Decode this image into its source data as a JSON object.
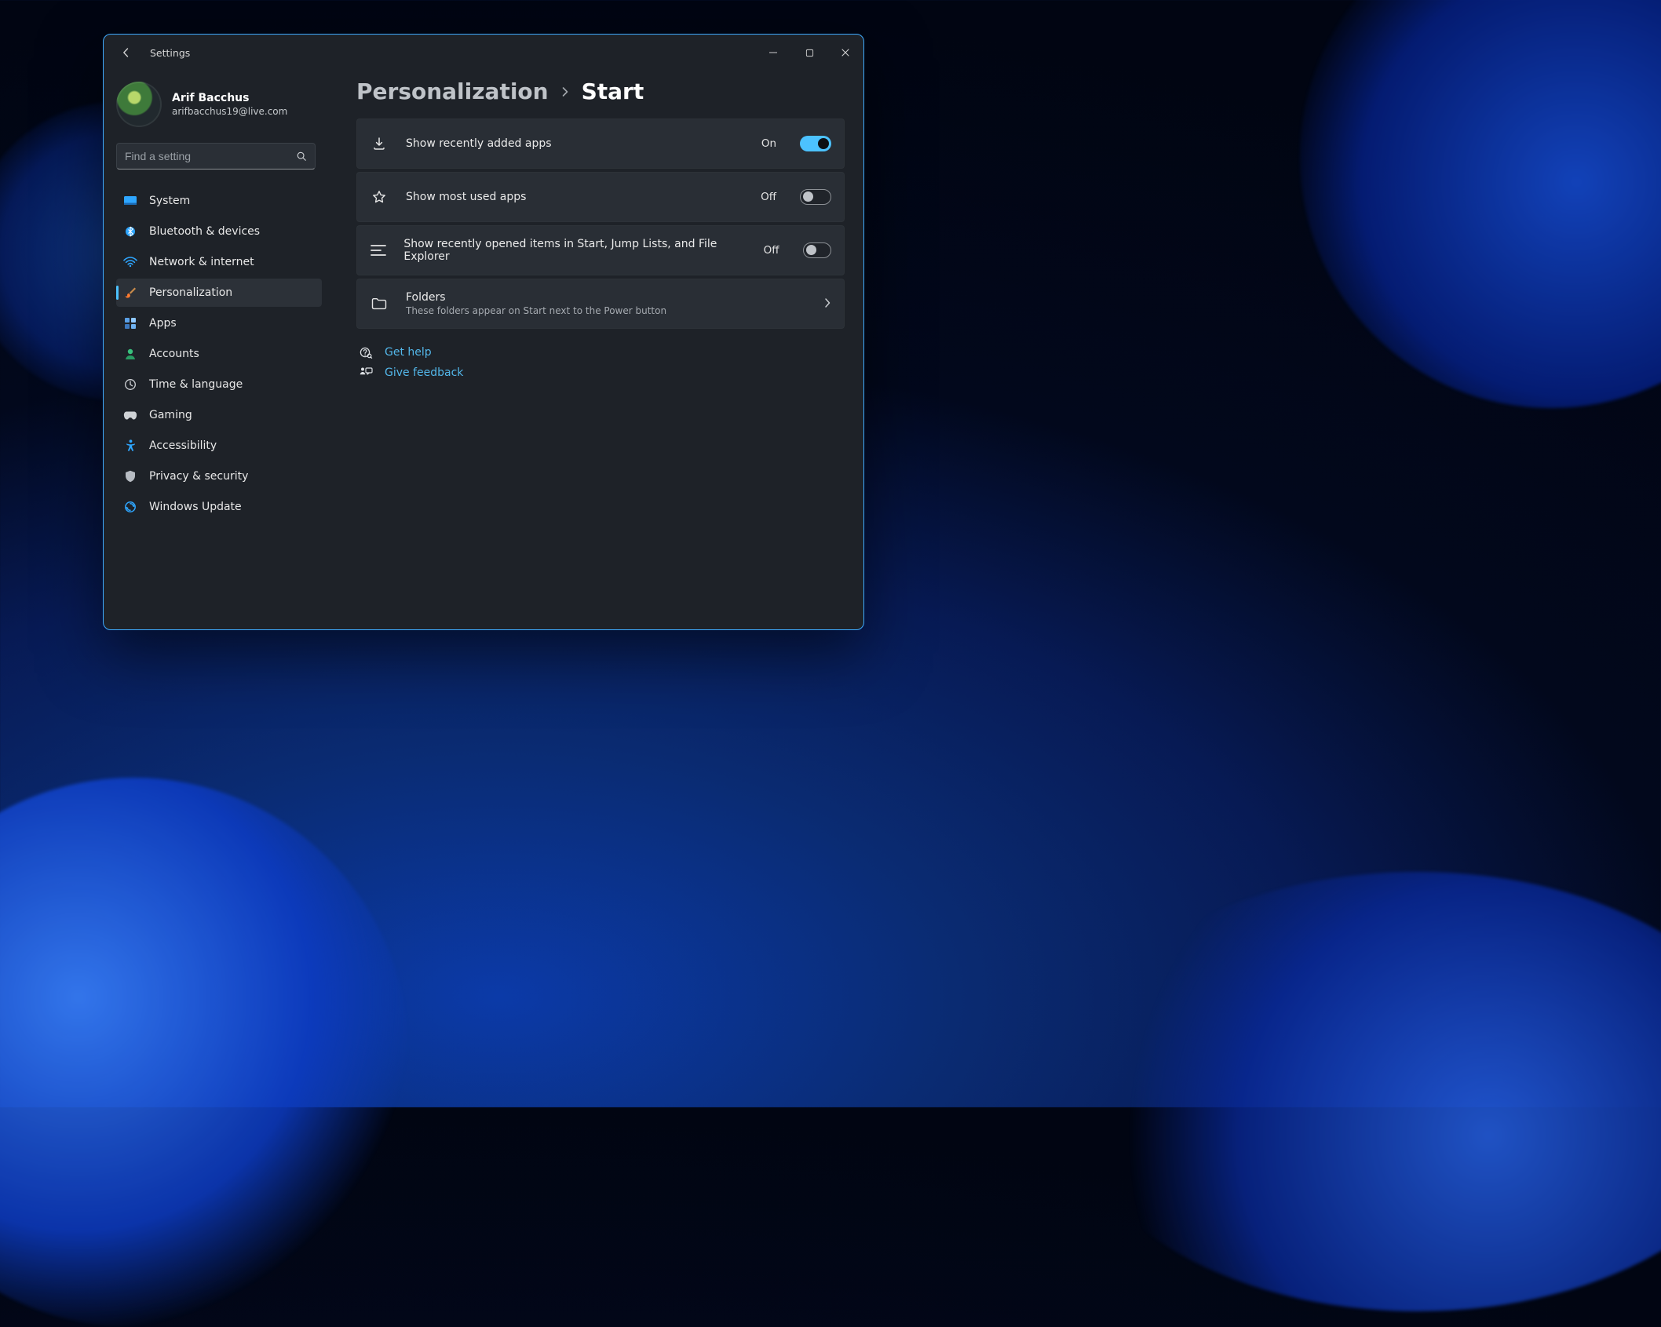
{
  "window": {
    "title": "Settings"
  },
  "user": {
    "name": "Arif Bacchus",
    "email": "arifbacchus19@live.com"
  },
  "search": {
    "placeholder": "Find a setting"
  },
  "nav": {
    "items": [
      {
        "label": "System"
      },
      {
        "label": "Bluetooth & devices"
      },
      {
        "label": "Network & internet"
      },
      {
        "label": "Personalization"
      },
      {
        "label": "Apps"
      },
      {
        "label": "Accounts"
      },
      {
        "label": "Time & language"
      },
      {
        "label": "Gaming"
      },
      {
        "label": "Accessibility"
      },
      {
        "label": "Privacy & security"
      },
      {
        "label": "Windows Update"
      }
    ],
    "active_index": 3
  },
  "breadcrumb": {
    "parent": "Personalization",
    "current": "Start"
  },
  "settings": {
    "recently_added": {
      "label": "Show recently added apps",
      "state": "On",
      "on": true
    },
    "most_used": {
      "label": "Show most used apps",
      "state": "Off",
      "on": false
    },
    "recent_items": {
      "label": "Show recently opened items in Start, Jump Lists, and File Explorer",
      "state": "Off",
      "on": false
    },
    "folders": {
      "label": "Folders",
      "sub": "These folders appear on Start next to the Power button"
    }
  },
  "help": {
    "get_help": "Get help",
    "give_feedback": "Give feedback"
  },
  "colors": {
    "accent": "#4cc2ff",
    "link": "#53b7ea"
  }
}
